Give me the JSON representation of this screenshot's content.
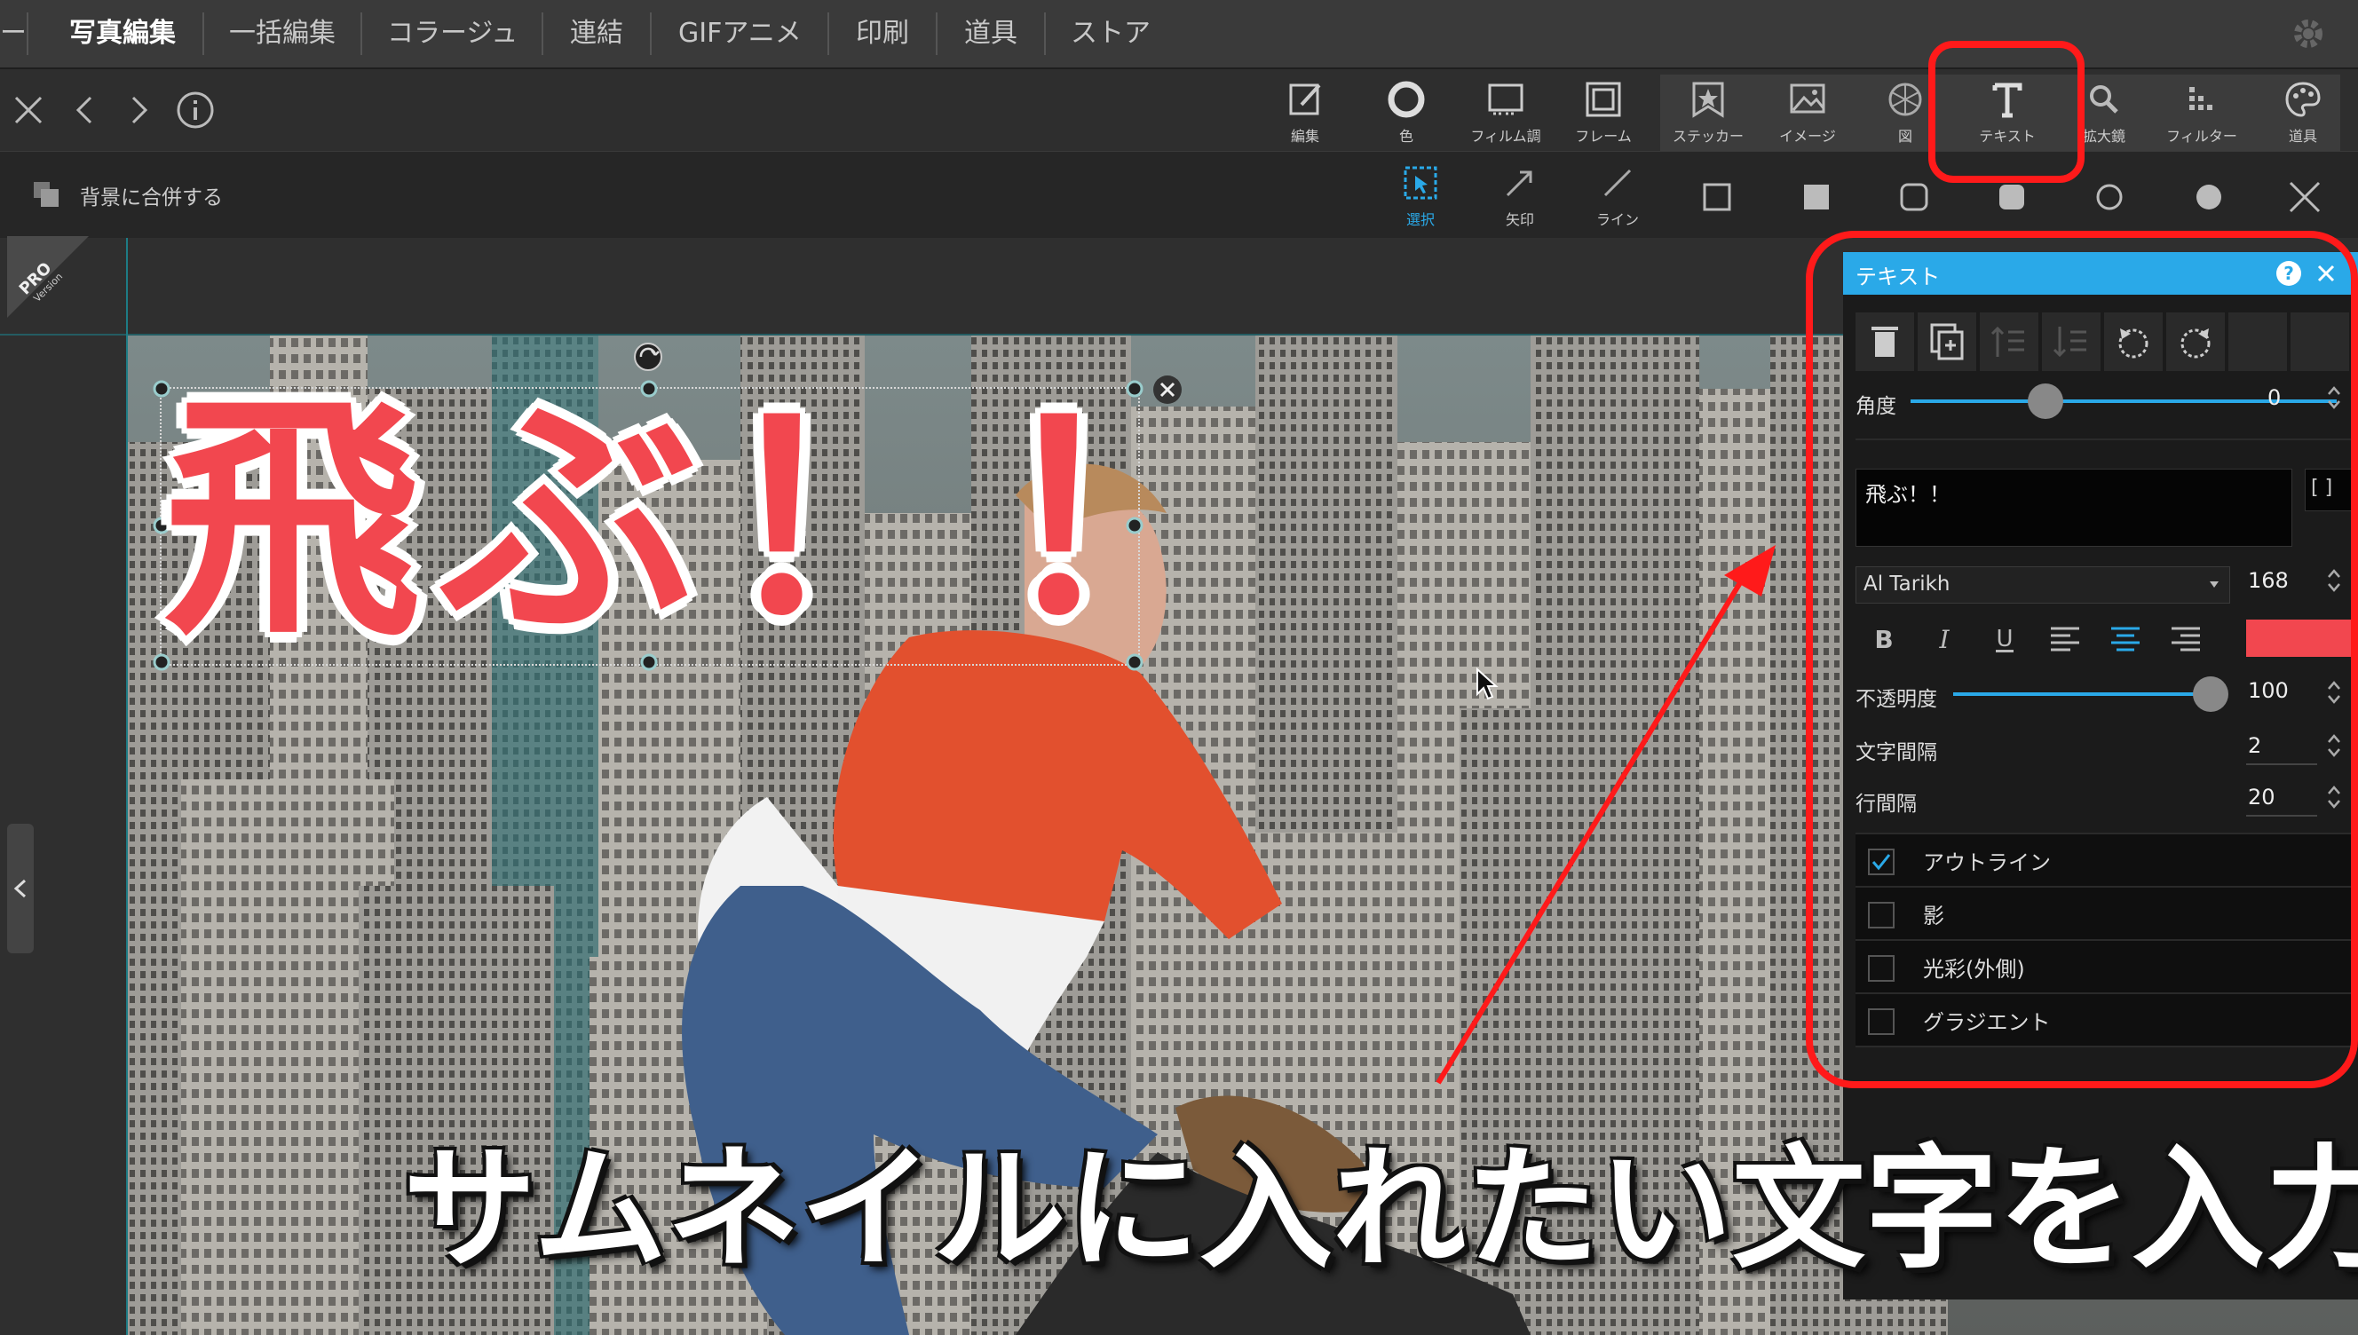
{
  "nav": {
    "tabs": [
      {
        "label": "ー"
      },
      {
        "label": "写真編集"
      },
      {
        "label": "一括編集"
      },
      {
        "label": "コラージュ"
      },
      {
        "label": "連結"
      },
      {
        "label": "GIFアニメ"
      },
      {
        "label": "印刷"
      },
      {
        "label": "道具"
      },
      {
        "label": "ストア"
      }
    ]
  },
  "tools": [
    {
      "label": "編集",
      "icon": "edit-icon"
    },
    {
      "label": "色",
      "icon": "color-icon"
    },
    {
      "label": "フィルム調",
      "icon": "film-icon"
    },
    {
      "label": "フレーム",
      "icon": "frame-icon"
    },
    {
      "label": "ステッカー",
      "icon": "sticker-icon"
    },
    {
      "label": "イメージ",
      "icon": "image-icon"
    },
    {
      "label": "図",
      "icon": "shape-icon"
    },
    {
      "label": "テキスト",
      "icon": "text-icon"
    },
    {
      "label": "拡大鏡",
      "icon": "magnifier-icon"
    },
    {
      "label": "フィルター",
      "icon": "filter-icon"
    },
    {
      "label": "道具",
      "icon": "palette-icon"
    }
  ],
  "subbar": {
    "merge_label": "背景に合併する",
    "select_label": "選択",
    "arrow_label": "矢印",
    "line_label": "ライン"
  },
  "pro_badge": {
    "line1": "PRO",
    "line2": "Version"
  },
  "canvas": {
    "overlay_text": "飛ぶ！！",
    "caption": "サムネイルに入れたい文字を入力"
  },
  "panel": {
    "title": "テキスト",
    "angle_label": "角度",
    "angle_value": "0",
    "angle_fraction": 0.5,
    "text_value": "飛ぶ！！",
    "bracket": "[ ]",
    "font_name": "Al Tarikh",
    "font_size": "168",
    "text_color": "#f2474f",
    "opacity_label": "不透明度",
    "opacity_value": "100",
    "opacity_fraction": 1.0,
    "spacing_label": "文字間隔",
    "spacing_value": "2",
    "line_label": "行間隔",
    "line_value": "20",
    "options": [
      {
        "label": "アウトライン",
        "checked": true
      },
      {
        "label": "影",
        "checked": false
      },
      {
        "label": "光彩(外側)",
        "checked": false
      },
      {
        "label": "グラジエント",
        "checked": false
      }
    ]
  },
  "colors": {
    "accent": "#2aa9e8",
    "highlight": "#ff1a1a",
    "title_red": "#f2474f"
  }
}
